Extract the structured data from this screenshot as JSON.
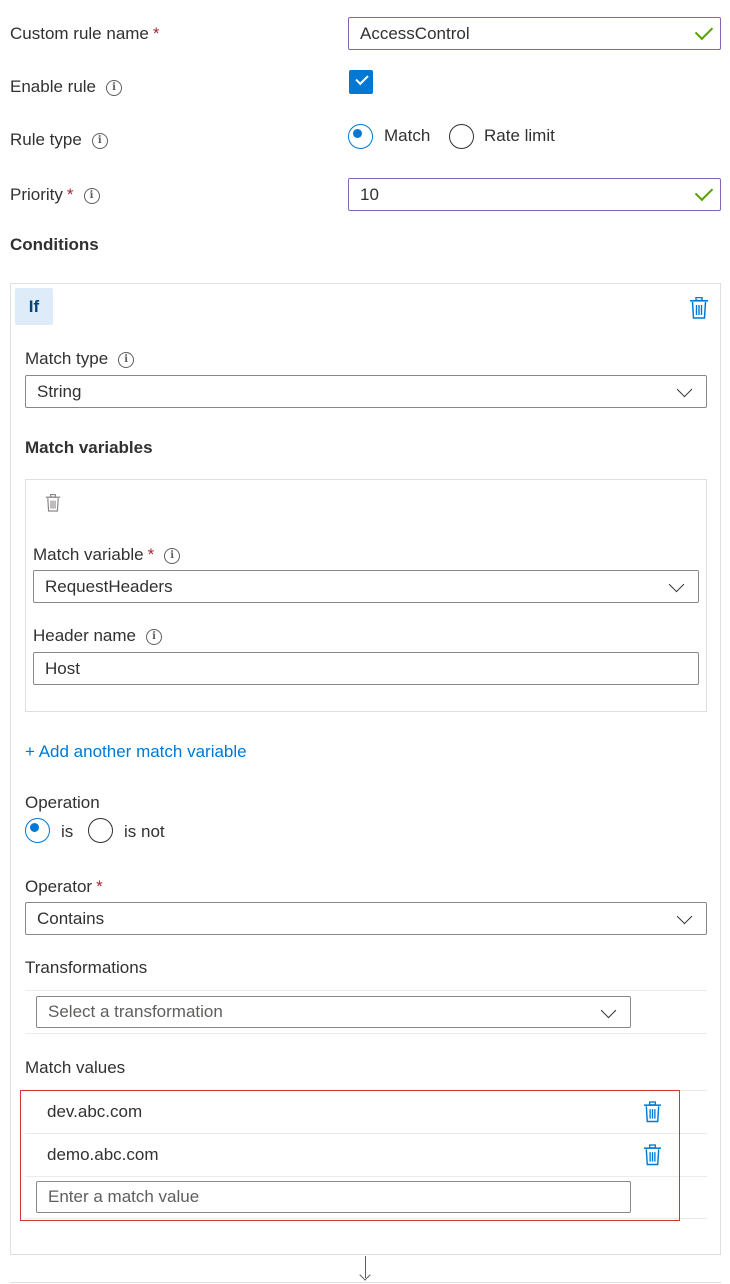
{
  "form": {
    "rule_name_label": "Custom rule name",
    "rule_name_value": "AccessControl",
    "enable_label": "Enable rule",
    "rule_type_label": "Rule type",
    "rule_type_options": [
      "Match",
      "Rate limit"
    ],
    "priority_label": "Priority",
    "priority_value": "10",
    "required_mark": "*",
    "info_glyph": "i"
  },
  "conditions": {
    "title": "Conditions",
    "if_label": "If",
    "match_type_label": "Match type",
    "match_type_value": "String",
    "match_variables_title": "Match variables",
    "match_variable_label": "Match variable",
    "match_variable_value": "RequestHeaders",
    "header_name_label": "Header name",
    "header_name_value": "Host",
    "add_variable_link": "+ Add another match variable",
    "operation_label": "Operation",
    "operation_options": [
      "is",
      "is not"
    ],
    "operator_label": "Operator",
    "operator_value": "Contains",
    "transformations_label": "Transformations",
    "transformation_placeholder": "Select a transformation",
    "match_values_label": "Match values",
    "match_values": [
      "dev.abc.com",
      "demo.abc.com"
    ],
    "match_value_placeholder": "Enter a match value"
  },
  "colors": {
    "accent": "#0078d4",
    "valid_border": "#8764b8",
    "valid_check": "#57a300",
    "required": "#a4262c",
    "highlight_box": "#d13438"
  },
  "icons": [
    "info-icon",
    "checkmark-icon",
    "delete-icon",
    "chevron-down-icon",
    "arrow-down-icon"
  ]
}
